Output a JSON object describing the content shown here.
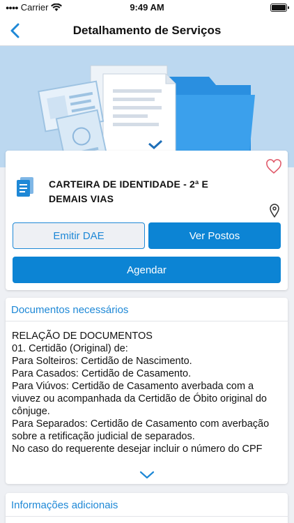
{
  "status_bar": {
    "carrier": "Carrier",
    "time": "9:49 AM"
  },
  "nav": {
    "title": "Detalhamento de Serviços",
    "back_icon": "chevron-left-icon"
  },
  "service": {
    "title": "CARTEIRA DE IDENTIDADE - 2ª E DEMAIS VIAS",
    "favorite_icon": "heart-outline-icon",
    "location_icon": "map-pin-icon",
    "buttons": {
      "emitir": "Emitir DAE",
      "postos": "Ver Postos",
      "agendar": "Agendar"
    }
  },
  "documents": {
    "header": "Documentos necessários",
    "lines": [
      "RELAÇÃO DE DOCUMENTOS",
      "01. Certidão (Original) de:",
      "Para Solteiros: Certidão de Nascimento.",
      "Para Casados: Certidão de Casamento.",
      "Para Viúvos: Certidão de Casamento averbada com a viuvez ou acompanhada da Certidão de Óbito original do cônjuge.",
      "Para Separados: Certidão de Casamento com averbação sobre a retificação judicial de separados.",
      "No caso do requerente desejar incluir o número do CPF"
    ],
    "expand_icon": "chevron-down-icon"
  },
  "additional_info": {
    "header": "Informações adicionais"
  },
  "colors": {
    "accent": "#0c84d4",
    "hero_bg": "#bcd8f0",
    "background": "#eef0f4"
  }
}
